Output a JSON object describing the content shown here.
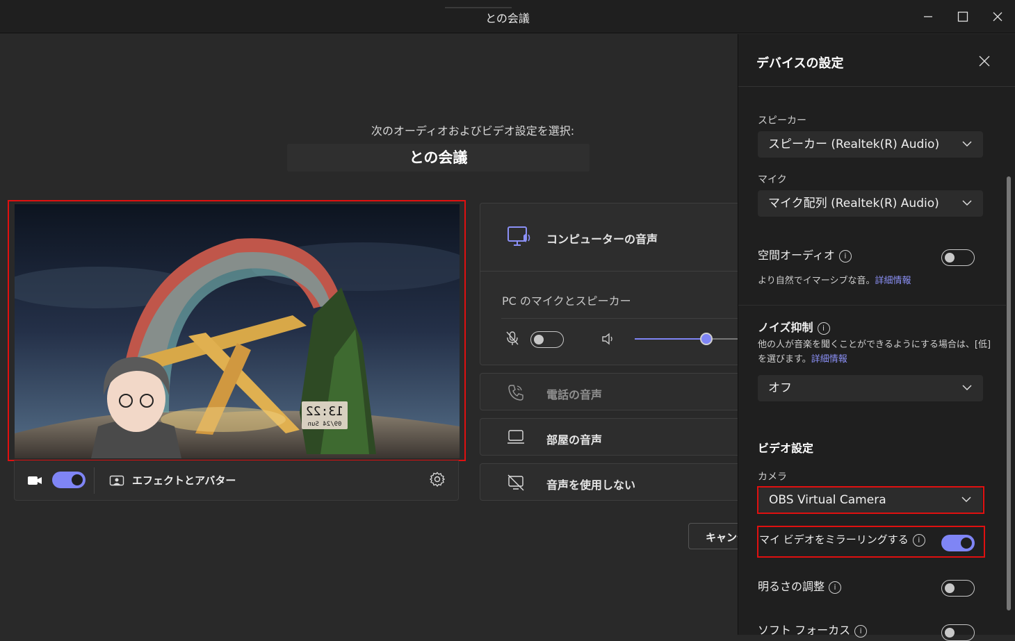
{
  "window": {
    "title": "との会議"
  },
  "main": {
    "subtitle": "次のオーディオおよびビデオ設定を選択:",
    "meeting_title": "との会議",
    "preview": {
      "clock_time": "13:22",
      "clock_date": "09/24 Sun"
    },
    "video_controls": {
      "camera_on": true,
      "effects_label": "エフェクトとアバター"
    },
    "audio": {
      "computer_audio_label": "コンピューターの音声",
      "pc_mic_speaker_label": "PC のマイクとスピーカー",
      "mic_muted": true,
      "volume_level": 0.52,
      "phone_audio_label": "電話の音声",
      "room_audio_label": "部屋の音声",
      "no_audio_label": "音声を使用しない"
    },
    "cancel_label": "キャンセル"
  },
  "panel": {
    "title": "デバイスの設定",
    "speaker": {
      "label": "スピーカー",
      "value": "スピーカー (Realtek(R) Audio)"
    },
    "mic": {
      "label": "マイク",
      "value": "マイク配列 (Realtek(R) Audio)"
    },
    "spatial": {
      "label": "空間オーディオ",
      "desc": "より自然でイマーシブな音。",
      "link": "詳細情報",
      "on": false
    },
    "noise": {
      "label": "ノイズ抑制",
      "desc1": "他の人が音楽を聞くことができるようにする場合は、[低]",
      "desc2": "を選びます。",
      "link": "詳細情報",
      "value": "オフ"
    },
    "video_heading": "ビデオ設定",
    "camera": {
      "label": "カメラ",
      "value": "OBS Virtual Camera"
    },
    "mirror": {
      "label": "マイ ビデオをミラーリングする",
      "on": true
    },
    "brightness": {
      "label": "明るさの調整",
      "on": false
    },
    "soft_focus": {
      "label": "ソフト フォーカス",
      "on": false
    }
  },
  "colors": {
    "accent": "#7f85f5",
    "highlight": "#e01010",
    "link": "#8b90f6"
  }
}
